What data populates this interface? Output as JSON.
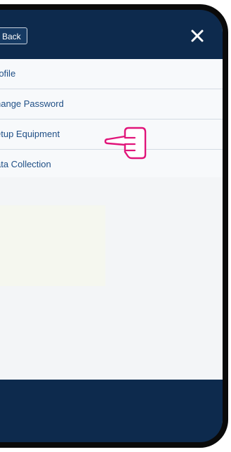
{
  "header": {
    "back_label": "Back",
    "close_icon": "close-icon"
  },
  "menu": {
    "items": [
      {
        "label": "rofile"
      },
      {
        "label": "hange Password"
      },
      {
        "label": "etup Equipment"
      },
      {
        "label": "ata Collection"
      }
    ]
  },
  "pointer": {
    "icon": "pointing-hand-icon",
    "color": "#e0157a",
    "target": "etup Equipment"
  },
  "colors": {
    "header_bg": "#0d2a4d",
    "menu_text": "#1f4f86",
    "footer_bg": "#0d2a4d"
  }
}
